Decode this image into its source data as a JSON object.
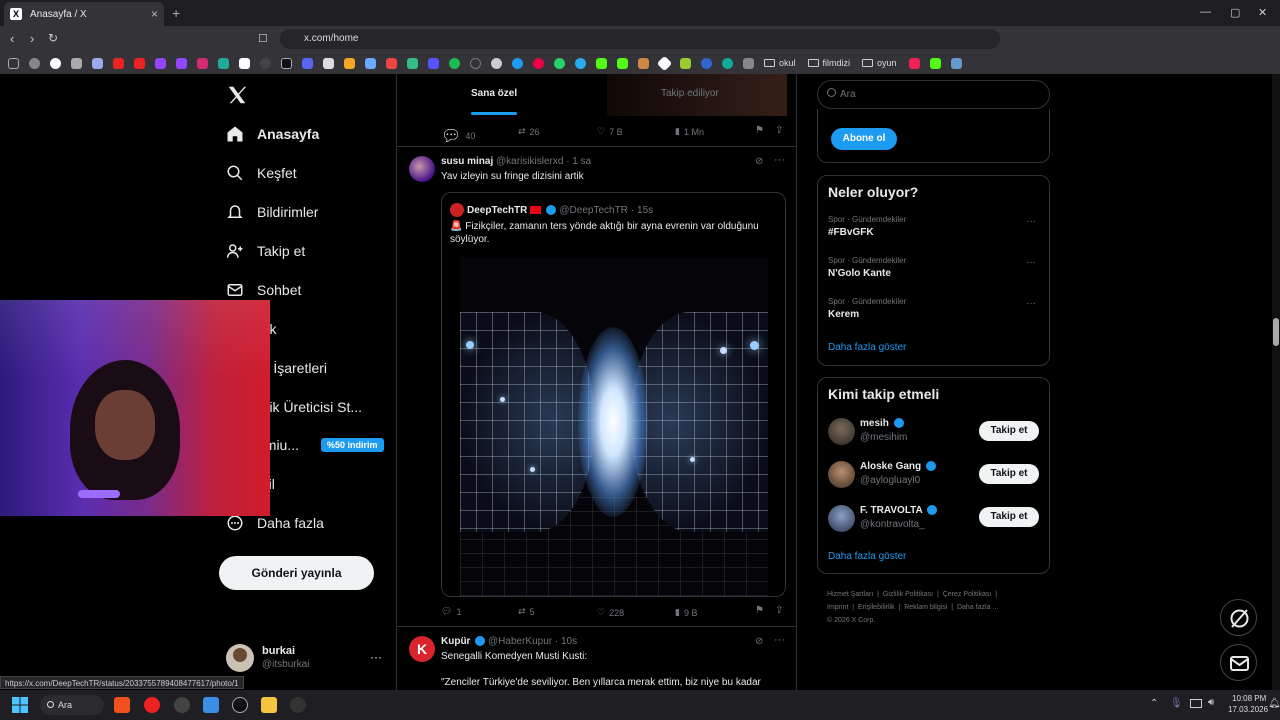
{
  "browser": {
    "tab_title": "Anasayfa / X",
    "tab_fav": "X",
    "url": "x.com/home",
    "bookmark_folders": [
      "okul",
      "filmdizi",
      "oyun"
    ],
    "status_url": "https://x.com/DeepTechTR/status/2033755789408477617/photo/1"
  },
  "nav": {
    "items": [
      {
        "label": "Anasayfa",
        "icon": "home-icon"
      },
      {
        "label": "Keşfet",
        "icon": "search-icon"
      },
      {
        "label": "Bildirimler",
        "icon": "bell-icon"
      },
      {
        "label": "Takip et",
        "icon": "add-user-icon"
      },
      {
        "label": "Sohbet",
        "icon": "mail-icon"
      },
      {
        "label": "rok",
        "icon": "grok-icon"
      },
      {
        "label": "er İşaretleri",
        "icon": "bookmark-icon"
      },
      {
        "label": "erik Üreticisi St...",
        "icon": "creator-icon"
      },
      {
        "label": "emiu...",
        "icon": "premium-icon"
      },
      {
        "label": "ofil",
        "icon": "profile-icon"
      },
      {
        "label": "Daha fazla",
        "icon": "more-icon"
      }
    ],
    "premium_badge": "%50 indirim",
    "post_button": "Gönderi yayınla",
    "account_name": "burkai",
    "account_handle": "@itsburkai"
  },
  "feed": {
    "tabs": [
      "Sana özel",
      "Takip ediliyor"
    ],
    "prev_tweet_actions": {
      "replies": "40",
      "retweets": "26",
      "likes": "7 B",
      "views": "1 Mn"
    },
    "tweet1": {
      "name": "susu minaj",
      "handle": "@karisikislerxd",
      "time": "· 1 sa",
      "text": "Yav izleyin su fringe dizisini artik",
      "quote": {
        "name": "DeepTechTR",
        "handle": "@DeepTechTR",
        "time": "· 15s",
        "text": "🚨 Fizikçiler, zamanın ters yönde aktığı bir ayna evrenin var olduğunu söylüyor."
      },
      "actions": {
        "replies": "1",
        "retweets": "5",
        "likes": "228",
        "views": "9 B"
      }
    },
    "tweet2": {
      "name": "Kupür",
      "handle": "@HaberKupur",
      "time": "· 10s",
      "avatar_letter": "K",
      "line1": "Senegalli Komedyen Musti Kusti:",
      "line2": "\"Zenciler Türkiye'de seviliyor. Ben yıllarca merak ettim, biz niye bu kadar"
    }
  },
  "right": {
    "search_placeholder": "Ara",
    "subscribe_button": "Abone ol",
    "trends_title": "Neler oluyor?",
    "trends": [
      {
        "category": "Spor · Gündemdekiler",
        "name": "#FBvGFK"
      },
      {
        "category": "Spor · Gündemdekiler",
        "name": "N'Golo Kante"
      },
      {
        "category": "Spor · Gündemdekiler",
        "name": "Kerem"
      }
    ],
    "show_more": "Daha fazla göster",
    "who_to_follow_title": "Kimi takip etmeli",
    "suggestions": [
      {
        "name": "mesih",
        "handle": "@mesihim"
      },
      {
        "name": "Aloske Gang",
        "handle": "@aylogluayl0"
      },
      {
        "name": "F. TRAVOLTA",
        "handle": "@kontravolta_"
      }
    ],
    "follow_label": "Takip et",
    "footer": [
      "Hizmet Şartları",
      "Gizlilik Politikası",
      "Çerez Politikası",
      "Imprint",
      "Erişilebilirlik",
      "Reklam bilgisi",
      "Daha fazla ...",
      "© 2026 X Corp."
    ]
  },
  "taskbar": {
    "search_label": "Ara",
    "time": "10:08 PM",
    "date": "17.03.2026"
  }
}
